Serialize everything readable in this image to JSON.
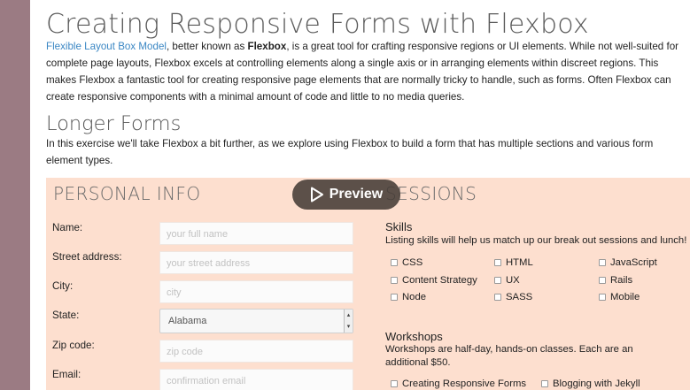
{
  "page": {
    "title": "Creating Responsive Forms with Flexbox",
    "intro_link": "Flexible Layout Box Model",
    "intro_text1": ", better known as ",
    "intro_bold": "Flexbox",
    "intro_text2": ", is a great tool for crafting responsive regions or UI elements. While not well-suited for complete page layouts, Flexbox excels at controlling elements along a single axis or in arranging elements within discreet regions. This makes Flexbox a fantastic tool for creating responsive page elements that are normally tricky to handle, such as forms. Often Flexbox can create responsive components with a minimal amount of code and little to no media queries.",
    "section_title": "Longer Forms",
    "section_desc": "In this exercise we'll take Flexbox a bit further, as we explore using Flexbox to build a form that has multiple sections and various form element types."
  },
  "personal": {
    "heading": "PERSONAL INFO",
    "fields": [
      {
        "label": "Name:",
        "placeholder": "your full name"
      },
      {
        "label": "Street address:",
        "placeholder": "your street address"
      },
      {
        "label": "City:",
        "placeholder": "city"
      },
      {
        "label": "State:",
        "value": "Alabama"
      },
      {
        "label": "Zip code:",
        "placeholder": "zip code"
      },
      {
        "label": "Email:",
        "placeholder": "confirmation email"
      }
    ]
  },
  "sessions": {
    "heading": "SESSIONS",
    "skills_title": "Skills",
    "skills_desc": "Listing skills will help us match up our break out sessions and lunch!",
    "skills": [
      "CSS",
      "HTML",
      "JavaScript",
      "Content Strategy",
      "UX",
      "Rails",
      "Node",
      "SASS",
      "Mobile"
    ],
    "workshops_title": "Workshops",
    "workshops_desc": "Workshops are half-day, hands-on classes. Each are an additional $50.",
    "workshops": [
      "Creating Responsive Forms",
      "Blogging with Jekyll"
    ]
  },
  "overlay": {
    "preview_label": "Preview"
  },
  "colors": {
    "sidebar": "#9b7b83",
    "panel": "#fddfcf",
    "link": "#3b87c4"
  }
}
